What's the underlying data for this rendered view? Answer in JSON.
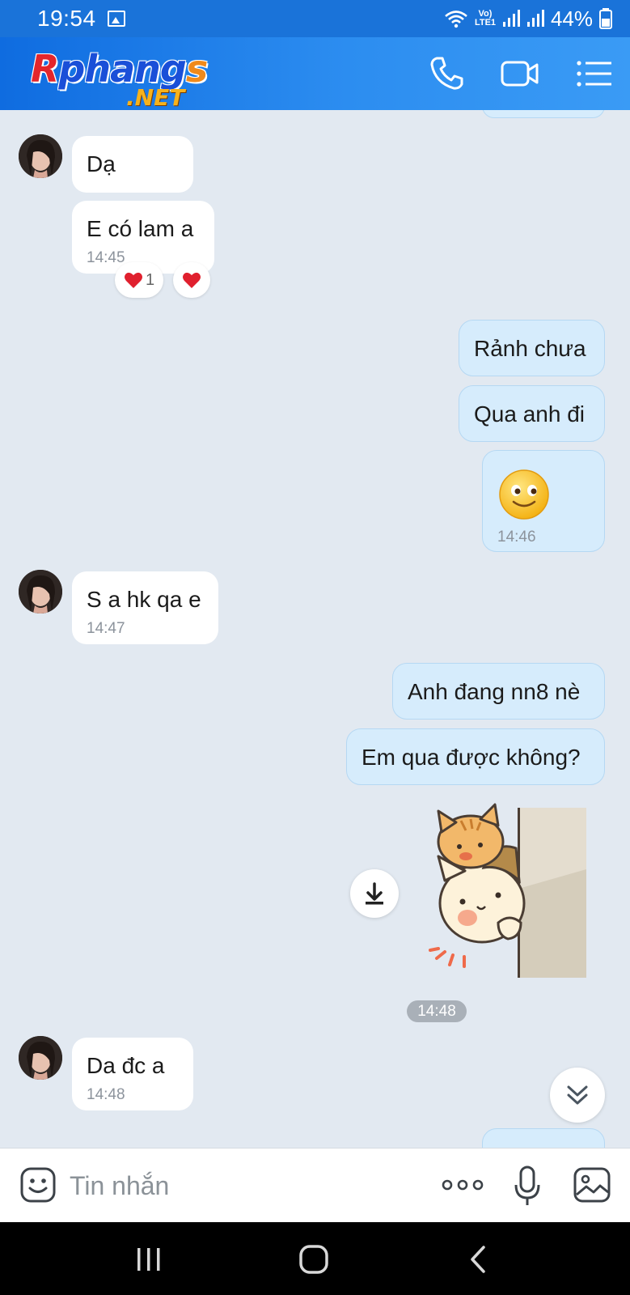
{
  "status_bar": {
    "time": "19:54",
    "network_label": "Vo) LTE1",
    "battery": "44%"
  },
  "header": {
    "logo_main_r": "R",
    "logo_main_mid": "phang",
    "logo_main_s": "s",
    "logo_net": ".NET"
  },
  "messages": [
    {
      "side": "in",
      "text": "Dạ",
      "time": ""
    },
    {
      "side": "in",
      "text": "E có lam a",
      "time": "14:45",
      "reaction_count": "1"
    },
    {
      "side": "out",
      "text": "Rảnh chưa",
      "time": ""
    },
    {
      "side": "out",
      "text": "Qua anh đi",
      "time": ""
    },
    {
      "side": "out",
      "text": "",
      "time": "14:46",
      "content": "smile-emoji"
    },
    {
      "side": "in",
      "text": "S a hk qa e",
      "time": "14:47"
    },
    {
      "side": "out",
      "text": "Anh đang nn8 nè",
      "time": ""
    },
    {
      "side": "out",
      "text": "Em qua được không?",
      "time": ""
    },
    {
      "side": "out",
      "text": "",
      "time": "14:48",
      "content": "cat-peeking-sticker"
    },
    {
      "side": "in",
      "text": "Da đc a",
      "time": "14:48"
    }
  ],
  "input": {
    "placeholder": "Tin nhắn"
  },
  "colors": {
    "header_blue": "#1a73d9",
    "incoming_bubble": "#ffffff",
    "outgoing_bubble": "#d6ecfc",
    "chat_background": "#e2e9f1"
  },
  "icons": {
    "header": [
      "phone-icon",
      "video-call-icon",
      "menu-icon"
    ],
    "input": [
      "emoji-icon",
      "more-icon",
      "microphone-icon",
      "image-icon"
    ],
    "nav": [
      "recent-apps-icon",
      "home-icon",
      "back-icon"
    ]
  }
}
